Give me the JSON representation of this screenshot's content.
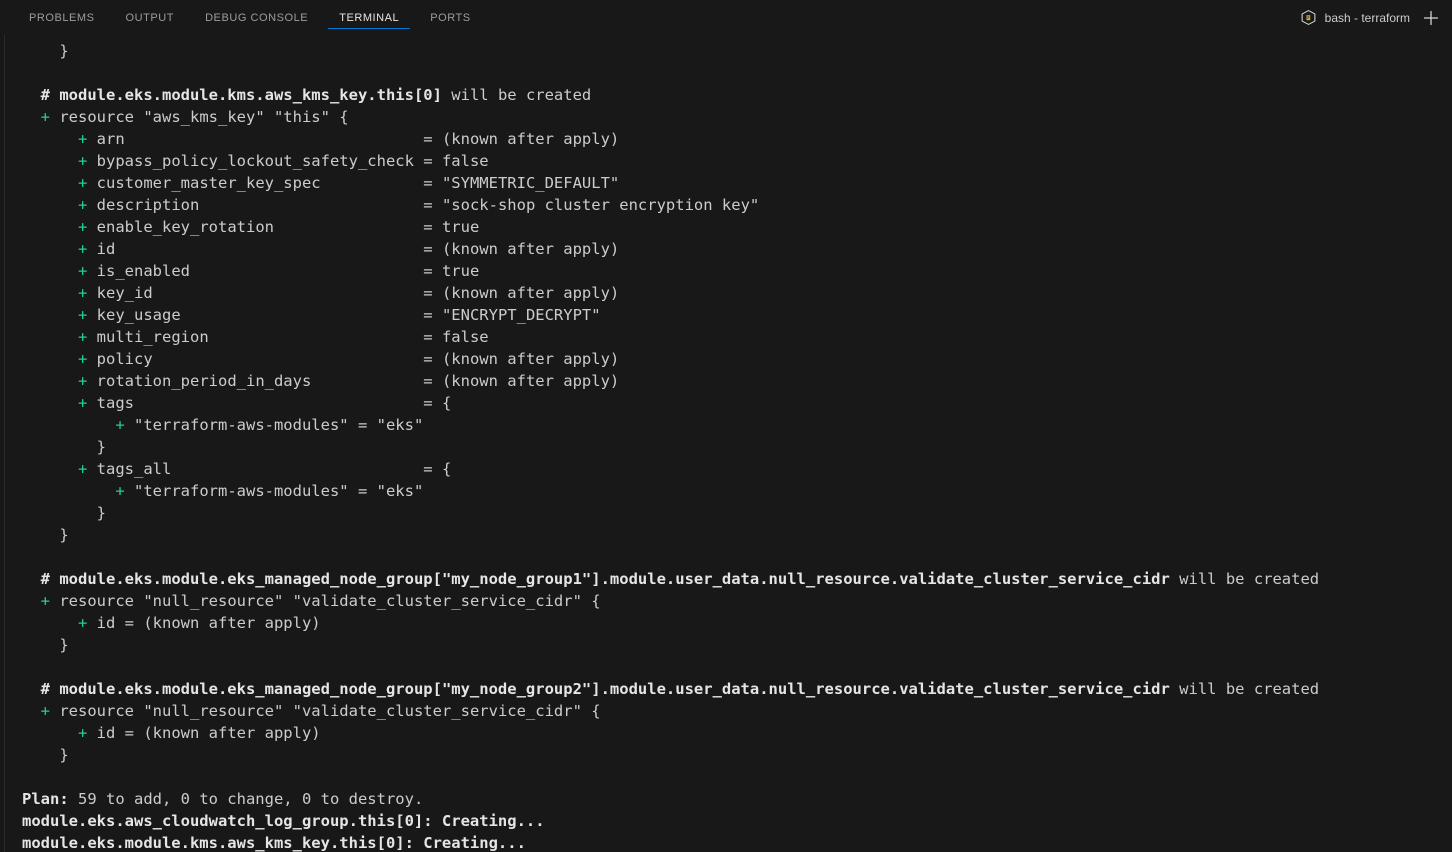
{
  "panel": {
    "tabs": [
      {
        "label": "PROBLEMS",
        "active": false
      },
      {
        "label": "OUTPUT",
        "active": false
      },
      {
        "label": "DEBUG CONSOLE",
        "active": false
      },
      {
        "label": "TERMINAL",
        "active": true
      },
      {
        "label": "PORTS",
        "active": false
      }
    ],
    "terminal_name": "bash - terraform",
    "terminal_icon": "cube-icon",
    "new_terminal_icon": "plus-icon",
    "accent_color": "#0078d4",
    "background_color": "#181818"
  },
  "terminal": {
    "colors": {
      "foreground": "#cccccc",
      "bold": "#e5e5e5",
      "green": "#23d18b"
    },
    "lines": [
      {
        "indent": "    ",
        "text": "}"
      },
      {
        "indent": "",
        "text": ""
      },
      {
        "indent": "  ",
        "bold": "# module.eks.module.kms.aws_kms_key.this[0]",
        "text": " will be created"
      },
      {
        "indent": "  ",
        "plus": "+",
        "text": " resource \"aws_kms_key\" \"this\" {"
      },
      {
        "indent": "      ",
        "plus": "+",
        "text": " arn                                = (known after apply)"
      },
      {
        "indent": "      ",
        "plus": "+",
        "text": " bypass_policy_lockout_safety_check = false"
      },
      {
        "indent": "      ",
        "plus": "+",
        "text": " customer_master_key_spec           = \"SYMMETRIC_DEFAULT\""
      },
      {
        "indent": "      ",
        "plus": "+",
        "text": " description                        = \"sock-shop cluster encryption key\""
      },
      {
        "indent": "      ",
        "plus": "+",
        "text": " enable_key_rotation                = true"
      },
      {
        "indent": "      ",
        "plus": "+",
        "text": " id                                 = (known after apply)"
      },
      {
        "indent": "      ",
        "plus": "+",
        "text": " is_enabled                         = true"
      },
      {
        "indent": "      ",
        "plus": "+",
        "text": " key_id                             = (known after apply)"
      },
      {
        "indent": "      ",
        "plus": "+",
        "text": " key_usage                          = \"ENCRYPT_DECRYPT\""
      },
      {
        "indent": "      ",
        "plus": "+",
        "text": " multi_region                       = false"
      },
      {
        "indent": "      ",
        "plus": "+",
        "text": " policy                             = (known after apply)"
      },
      {
        "indent": "      ",
        "plus": "+",
        "text": " rotation_period_in_days            = (known after apply)"
      },
      {
        "indent": "      ",
        "plus": "+",
        "text": " tags                               = {"
      },
      {
        "indent": "          ",
        "plus": "+",
        "text": " \"terraform-aws-modules\" = \"eks\""
      },
      {
        "indent": "        ",
        "text": "}"
      },
      {
        "indent": "      ",
        "plus": "+",
        "text": " tags_all                           = {"
      },
      {
        "indent": "          ",
        "plus": "+",
        "text": " \"terraform-aws-modules\" = \"eks\""
      },
      {
        "indent": "        ",
        "text": "}"
      },
      {
        "indent": "    ",
        "text": "}"
      },
      {
        "indent": "",
        "text": ""
      },
      {
        "indent": "  ",
        "bold": "# module.eks.module.eks_managed_node_group[\"my_node_group1\"].module.user_data.null_resource.validate_cluster_service_cidr",
        "text": " will be created"
      },
      {
        "indent": "  ",
        "plus": "+",
        "text": " resource \"null_resource\" \"validate_cluster_service_cidr\" {"
      },
      {
        "indent": "      ",
        "plus": "+",
        "text": " id = (known after apply)"
      },
      {
        "indent": "    ",
        "text": "}"
      },
      {
        "indent": "",
        "text": ""
      },
      {
        "indent": "  ",
        "bold": "# module.eks.module.eks_managed_node_group[\"my_node_group2\"].module.user_data.null_resource.validate_cluster_service_cidr",
        "text": " will be created"
      },
      {
        "indent": "  ",
        "plus": "+",
        "text": " resource \"null_resource\" \"validate_cluster_service_cidr\" {"
      },
      {
        "indent": "      ",
        "plus": "+",
        "text": " id = (known after apply)"
      },
      {
        "indent": "    ",
        "text": "}"
      },
      {
        "indent": "",
        "text": ""
      },
      {
        "indent": "",
        "bold": "Plan:",
        "text": " 59 to add, 0 to change, 0 to destroy."
      },
      {
        "indent": "",
        "bold": "module.eks.aws_cloudwatch_log_group.this[0]: Creating...",
        "text": ""
      },
      {
        "indent": "",
        "bold": "module.eks.module.kms.aws_kms_key.this[0]: Creating...",
        "text": ""
      }
    ],
    "plan_summary": {
      "label": "Plan:",
      "add": "59",
      "change": "0",
      "destroy": "0",
      "text": "59 to add, 0 to change, 0 to destroy."
    }
  }
}
